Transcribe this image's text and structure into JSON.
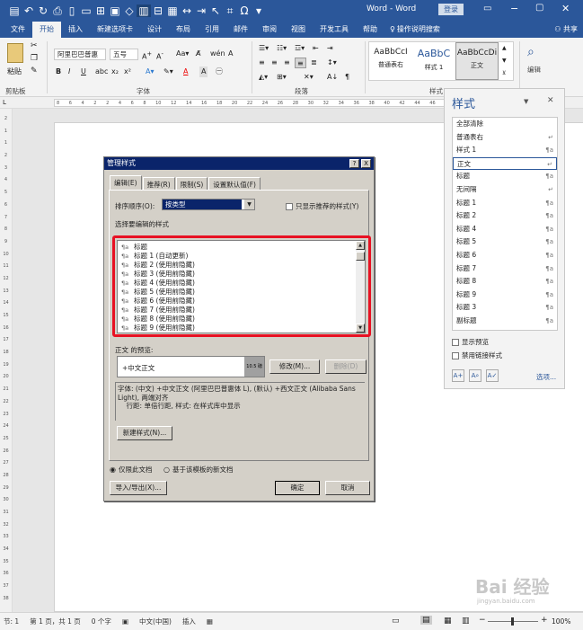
{
  "window": {
    "title": "Word - Word",
    "login": "登录",
    "share": "共享"
  },
  "ribbon_tabs": [
    "文件",
    "开始",
    "插入",
    "新建选项卡",
    "设计",
    "布局",
    "引用",
    "邮件",
    "审阅",
    "视图",
    "开发工具",
    "帮助"
  ],
  "tell_me": "操作说明搜索",
  "clipboard": {
    "paste": "粘贴",
    "label": "剪贴板"
  },
  "font": {
    "name": "阿里巴巴普惠",
    "size": "五号",
    "label": "字体"
  },
  "paragraph": {
    "label": "段落"
  },
  "styles": {
    "label": "样式",
    "gallery": [
      {
        "preview": "AaBbCcI",
        "name": "普通表右"
      },
      {
        "preview": "AaBbC",
        "name": "样式 1"
      },
      {
        "preview": "AaBbCcDi",
        "name": "正文"
      }
    ]
  },
  "editing": {
    "label": "编辑"
  },
  "ruler_ticks": [
    "8",
    "6",
    "4",
    "2",
    "2",
    "4",
    "6",
    "8",
    "10",
    "12",
    "14",
    "16",
    "18",
    "20",
    "22",
    "24",
    "26",
    "28",
    "30",
    "32",
    "34",
    "36",
    "38",
    "40",
    "42",
    "44",
    "46",
    "48"
  ],
  "vruler_ticks": [
    "2",
    "1",
    "1",
    "2",
    "3",
    "4",
    "5",
    "6",
    "7",
    "8",
    "9",
    "10",
    "11",
    "12",
    "13",
    "14",
    "15",
    "16",
    "17",
    "18",
    "19",
    "20",
    "21",
    "22",
    "23",
    "24",
    "25",
    "26",
    "27",
    "28",
    "29",
    "30",
    "31",
    "32",
    "33",
    "34",
    "35",
    "36",
    "37",
    "38"
  ],
  "dialog": {
    "title": "管理样式",
    "help": "?",
    "close": "X",
    "tabs": [
      "编辑(E)",
      "推荐(R)",
      "限制(S)",
      "设置默认值(F)"
    ],
    "sort_label": "排序顺序(O):",
    "sort_value": "按类型",
    "only_recommended": "只显示推荐的样式(Y)",
    "select_label": "选择要编辑的样式",
    "style_items": [
      "标题",
      "标题 1  (自动更新)",
      "标题 2  (使用前隐藏)",
      "标题 3  (使用前隐藏)",
      "标题 4  (使用前隐藏)",
      "标题 5  (使用前隐藏)",
      "标题 6  (使用前隐藏)",
      "标题 7  (使用前隐藏)",
      "标题 8  (使用前隐藏)",
      "标题 9  (使用前隐藏)"
    ],
    "item_icon": "¶a",
    "preview_label": "正文 的预览:",
    "preview_text": "+中文正文",
    "preview_size": "10.5 磅",
    "modify": "修改(M)...",
    "delete": "删除(D)",
    "description": "字体: (中文) +中文正文 (阿里巴巴普惠体 L), (默认) +西文正文 (Alibaba Sans Light), 两端对齐\n    行距: 单倍行距, 样式: 在样式库中显示",
    "new_style": "新建样式(N)...",
    "radio_doc": "仅限此文档",
    "radio_template": "基于该模板的新文档",
    "import_export": "导入/导出(X)...",
    "ok": "确定",
    "cancel": "取消"
  },
  "styles_pane": {
    "title": "样式",
    "items": [
      {
        "name": "全部清除",
        "mark": ""
      },
      {
        "name": "普通表右",
        "mark": "↵"
      },
      {
        "name": "样式 1",
        "mark": "¶a"
      },
      {
        "name": "正文",
        "mark": "↵"
      },
      {
        "name": "标题",
        "mark": "¶a"
      },
      {
        "name": "无间隔",
        "mark": "↵"
      },
      {
        "name": "标题 1",
        "mark": "¶a"
      },
      {
        "name": "标题 2",
        "mark": "¶a"
      },
      {
        "name": "标题 4",
        "mark": "¶a"
      },
      {
        "name": "标题 5",
        "mark": "¶a"
      },
      {
        "name": "标题 6",
        "mark": "¶a"
      },
      {
        "name": "标题 7",
        "mark": "¶a"
      },
      {
        "name": "标题 8",
        "mark": "¶a"
      },
      {
        "name": "标题 9",
        "mark": "¶a"
      },
      {
        "name": "标题 3",
        "mark": "¶a"
      },
      {
        "name": "副标题",
        "mark": "¶a"
      }
    ],
    "show_preview": "显示预览",
    "disable_linked": "禁用链接样式",
    "options": "选项..."
  },
  "status": {
    "page": "节: 1",
    "pages": "第 1 页，共 1 页",
    "words": "0 个字",
    "lang": "中文(中国)",
    "mode": "插入",
    "zoom": "100%"
  },
  "watermark": "Bai 经验",
  "watermark_url": "jingyan.baidu.com",
  "colors": {
    "brand": "#2b579a",
    "highlight": "#e81123"
  }
}
